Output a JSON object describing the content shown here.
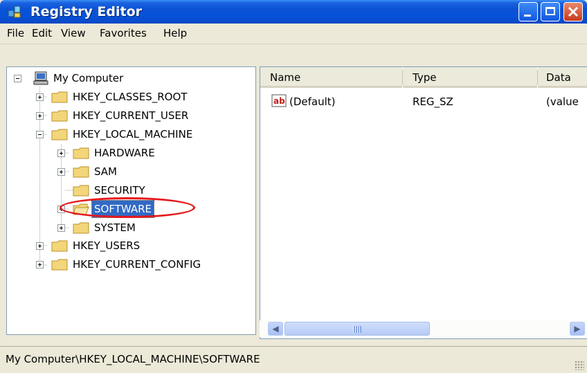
{
  "window": {
    "title": "Registry Editor"
  },
  "menu": [
    "File",
    "Edit",
    "View",
    "Favorites",
    "Help"
  ],
  "tree": {
    "root": "My Computer",
    "hives": [
      "HKEY_CLASSES_ROOT",
      "HKEY_CURRENT_USER",
      "HKEY_LOCAL_MACHINE",
      "HKEY_USERS",
      "HKEY_CURRENT_CONFIG"
    ],
    "local_machine_children": [
      "HARDWARE",
      "SAM",
      "SECURITY",
      "SOFTWARE",
      "SYSTEM"
    ],
    "selected": "SOFTWARE"
  },
  "list": {
    "columns": [
      "Name",
      "Type",
      "Data"
    ],
    "rows": [
      {
        "name": "(Default)",
        "type": "REG_SZ",
        "data": "(value"
      }
    ]
  },
  "status": "My Computer\\HKEY_LOCAL_MACHINE\\SOFTWARE",
  "colors": {
    "selection": "#316ac5",
    "title_bar": "#0a52d6",
    "annotation_ring": "#e5181c"
  }
}
